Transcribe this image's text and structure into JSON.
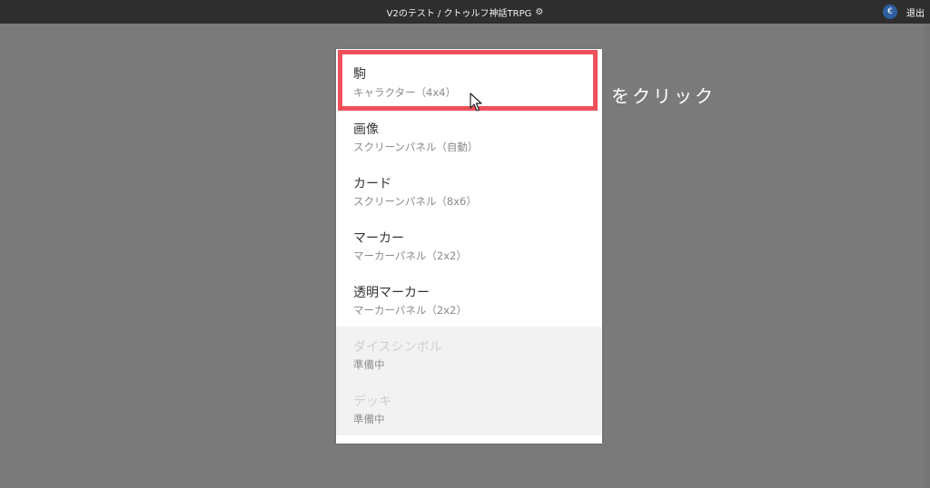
{
  "topbar": {
    "title": "V2のテスト / クトゥルフ神話TRPG",
    "gear_icon": "gear-icon",
    "avatar_text": "€",
    "logout_label": "退出"
  },
  "menu": {
    "items": [
      {
        "label": "駒",
        "sub": "キャラクター（4x4）",
        "disabled": false
      },
      {
        "label": "画像",
        "sub": "スクリーンパネル（自動）",
        "disabled": false
      },
      {
        "label": "カード",
        "sub": "スクリーンパネル（8x6）",
        "disabled": false
      },
      {
        "label": "マーカー",
        "sub": "マーカーパネル（2x2）",
        "disabled": false
      },
      {
        "label": "透明マーカー",
        "sub": "マーカーパネル（2x2）",
        "disabled": false
      },
      {
        "label": "ダイスシンボル",
        "sub": "準備中",
        "disabled": true
      },
      {
        "label": "デッキ",
        "sub": "準備中",
        "disabled": true
      }
    ]
  },
  "annotation": {
    "text": "をクリック",
    "highlight_color": "#f0505a"
  }
}
